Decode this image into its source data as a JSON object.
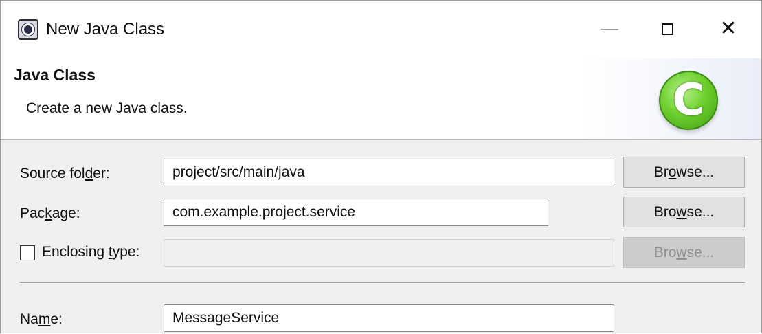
{
  "window": {
    "title": "New Java Class",
    "minimize_icon": "minimize-icon",
    "maximize_icon": "maximize-icon",
    "close_icon": "close-icon",
    "close_glyph": "✕"
  },
  "banner": {
    "title": "Java Class",
    "description": "Create a new Java class.",
    "icon": "java-class-icon",
    "icon_glyph": "C"
  },
  "form": {
    "source_folder": {
      "label_pre": "Source fol",
      "label_mnemonic": "d",
      "label_post": "er:",
      "value": "project/src/main/java",
      "browse": {
        "pre": "Br",
        "mnemonic": "o",
        "post": "wse..."
      }
    },
    "package": {
      "label_pre": "Pac",
      "label_mnemonic": "k",
      "label_post": "age:",
      "value": "com.example.project.service",
      "browse": {
        "pre": "Bro",
        "mnemonic": "w",
        "post": "se..."
      }
    },
    "enclosing_type": {
      "checked": false,
      "label_pre": "Enclosing ",
      "label_mnemonic": "t",
      "label_post": "ype:",
      "value": "",
      "browse": {
        "pre": "Bro",
        "mnemonic": "w",
        "post": "se..."
      }
    },
    "name": {
      "label_pre": "Na",
      "label_mnemonic": "m",
      "label_post": "e:",
      "value": "MessageService"
    }
  },
  "colors": {
    "accent_green": "#6fd02e",
    "button_face": "#e1e1e1",
    "dialog_background": "#f0f0f0"
  }
}
